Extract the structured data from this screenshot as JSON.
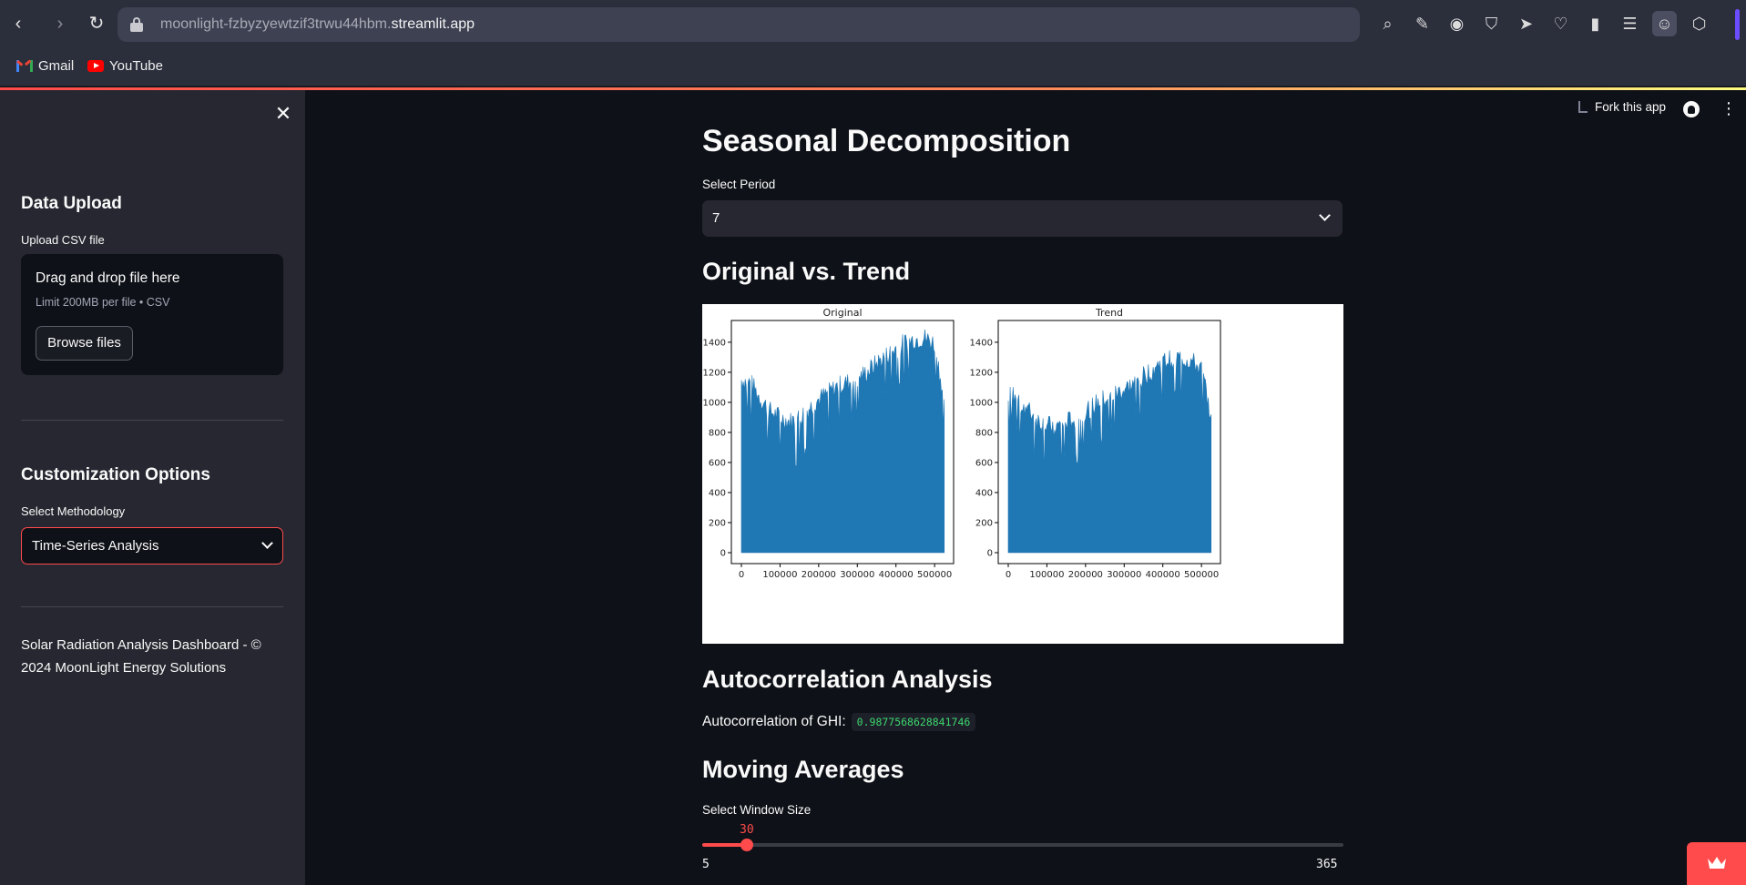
{
  "browser": {
    "url_prefix": "moonlight-fzbyzyewtzif3trwu44hbm.",
    "url_domain": "streamlit.app",
    "bookmarks": [
      {
        "label": "Gmail",
        "icon": "gmail-icon"
      },
      {
        "label": "YouTube",
        "icon": "youtube-icon"
      }
    ],
    "accent_color": "#6c4cff"
  },
  "app_header": {
    "fork_label": "Fork this app"
  },
  "sidebar": {
    "data_upload_title": "Data Upload",
    "upload_label": "Upload CSV file",
    "dropzone_title": "Drag and drop file here",
    "dropzone_limit": "Limit 200MB per file • CSV",
    "browse_label": "Browse files",
    "customization_title": "Customization Options",
    "methodology_label": "Select Methodology",
    "methodology_value": "Time-Series Analysis",
    "footer": "Solar Radiation Analysis Dashboard - © 2024 MoonLight Energy Solutions"
  },
  "main": {
    "title": "Seasonal Decomposition",
    "period_label": "Select Period",
    "period_value": "7",
    "section_trend": "Original vs. Trend",
    "section_autocorr": "Autocorrelation Analysis",
    "autocorr_label": "Autocorrelation of GHI:",
    "autocorr_value": "0.9877568628841746",
    "section_moving": "Moving Averages",
    "window_label": "Select Window Size",
    "slider": {
      "value": 30,
      "min": 5,
      "max": 365,
      "value_text": "30",
      "min_text": "5",
      "max_text": "365"
    }
  },
  "chart_data": [
    {
      "type": "area",
      "title": "Original",
      "xlabel": "",
      "ylabel": "",
      "xlim": [
        0,
        525600
      ],
      "ylim": [
        0,
        1400
      ],
      "x_ticks": [
        0,
        100000,
        200000,
        300000,
        400000,
        500000
      ],
      "y_ticks": [
        0,
        200,
        400,
        600,
        800,
        1000,
        1200,
        1400
      ],
      "envelope_x": [
        0,
        25000,
        50000,
        75000,
        100000,
        125000,
        150000,
        175000,
        200000,
        225000,
        250000,
        275000,
        300000,
        325000,
        350000,
        375000,
        400000,
        425000,
        450000,
        475000,
        500000,
        525000
      ],
      "envelope_y": [
        1150,
        1130,
        1020,
        940,
        900,
        870,
        900,
        960,
        1020,
        1060,
        1110,
        1130,
        1160,
        1200,
        1260,
        1310,
        1360,
        1400,
        1420,
        1430,
        1390,
        1020
      ],
      "color": "#1f77b4"
    },
    {
      "type": "area",
      "title": "Trend",
      "xlabel": "",
      "ylabel": "",
      "xlim": [
        0,
        525600
      ],
      "ylim": [
        0,
        1400
      ],
      "x_ticks": [
        0,
        100000,
        200000,
        300000,
        400000,
        500000
      ],
      "y_ticks": [
        0,
        200,
        400,
        600,
        800,
        1000,
        1200,
        1400
      ],
      "envelope_x": [
        0,
        25000,
        50000,
        75000,
        100000,
        125000,
        150000,
        175000,
        200000,
        225000,
        250000,
        275000,
        300000,
        325000,
        350000,
        375000,
        400000,
        425000,
        450000,
        475000,
        500000,
        525000
      ],
      "envelope_y": [
        1080,
        1020,
        950,
        880,
        840,
        830,
        860,
        900,
        940,
        980,
        1020,
        1050,
        1080,
        1120,
        1170,
        1220,
        1260,
        1290,
        1290,
        1270,
        1210,
        920
      ],
      "color": "#1f77b4"
    }
  ]
}
